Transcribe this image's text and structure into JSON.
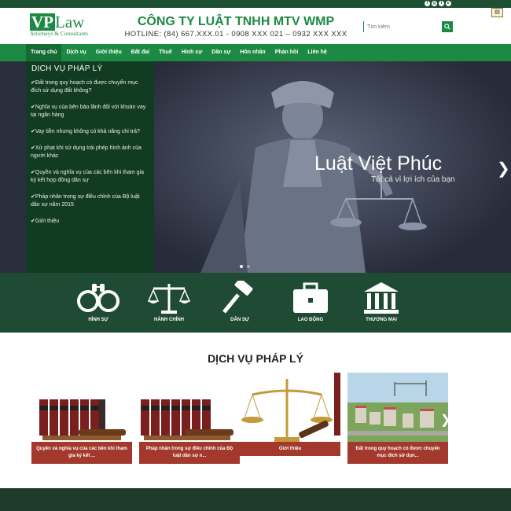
{
  "header": {
    "logo_vp": "VP",
    "logo_law": "Law",
    "logo_tagline": "Attorneys & Consultants",
    "company": "CÔNG TY LUẬT TNHH MTV WMP",
    "hotline": "HOTLINE: (84) 667.XXX.01 - 0908 XXX 021 – 0932 XXX XXX",
    "search_placeholder": "Tìm kiếm"
  },
  "nav": {
    "items": [
      "Trang chủ",
      "Dịch vụ",
      "Giới thiệu",
      "Đất đai",
      "Thuế",
      "Hình sự",
      "Dân sự",
      "Hôn nhân",
      "Phản hồi",
      "Liên hệ"
    ]
  },
  "sidebar": {
    "title": "DỊCH VỤ PHÁP LÝ",
    "items": [
      "Đất trong quy hoạch có được chuyển mục đích sử dụng đất không?",
      "Nghĩa vụ của bên bảo lãnh đối với khoản vay tại ngân hàng",
      "Vay tiền nhưng không có khả năng chi trả?",
      "Xử phạt khi sử dụng trái phép hình ảnh của người khác",
      "Quyền và nghĩa vụ của các bên khi tham gia ký kết hợp đồng dân sự",
      "Pháp nhân trong sự điều chỉnh của Bộ luật dân sự năm 2015",
      "Giới thiệu"
    ]
  },
  "hero": {
    "title": "Luật Việt Phúc",
    "subtitle": "Tất cả vì lợi ích của bạn"
  },
  "categories": [
    "HÌNH SỰ",
    "HÀNH CHÍNH",
    "DÂN SỰ",
    "LAO ĐỘNG",
    "THƯƠNG MẠI"
  ],
  "services": {
    "title": "DỊCH VỤ PHÁP LÝ",
    "cards": [
      "Quyền và nghĩa vụ của các bên khi tham gia ký kết ...",
      "Pháp nhân trong sự điều chỉnh của Bộ luật dân sự n...",
      "Giới thiệu",
      "Đất trong quy hoạch có được chuyển mục đích sử dụn..."
    ]
  },
  "colors": {
    "brand_green": "#1d8a43",
    "dark_green": "#123c21",
    "caption_red": "#a3392c"
  }
}
